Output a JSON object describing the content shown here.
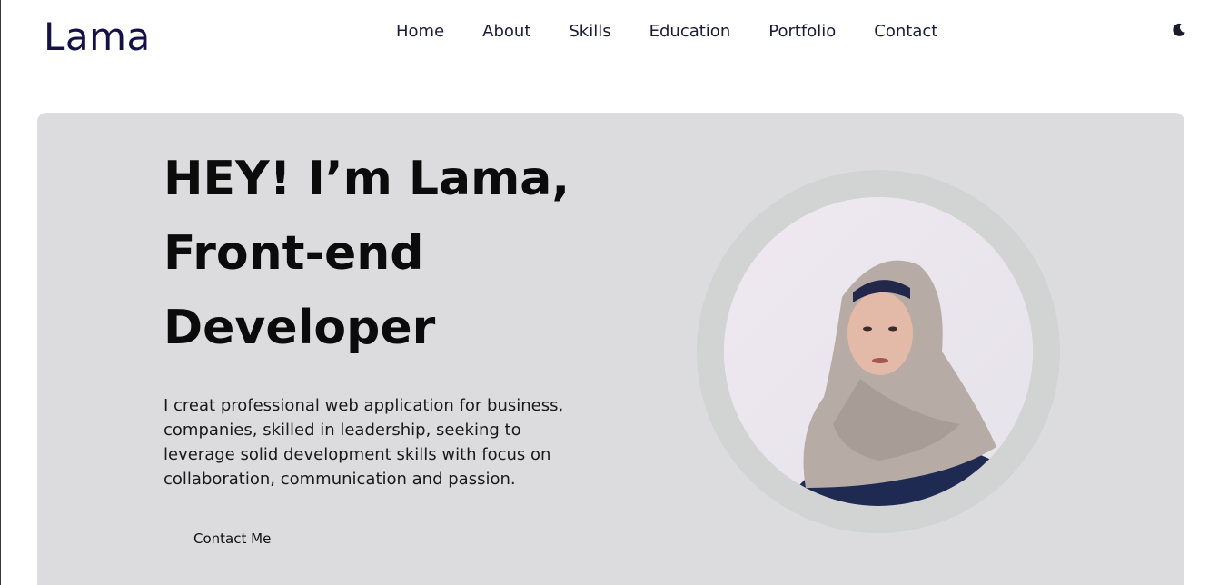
{
  "header": {
    "logo": "Lama",
    "nav": [
      "Home",
      "About",
      "Skills",
      "Education",
      "Portfolio",
      "Contact"
    ],
    "theme_icon": "moon-icon"
  },
  "hero": {
    "title_lines": [
      "HEY! I’m Lama,",
      "Front-end",
      "Developer"
    ],
    "description": "I creat professional web application for business, companies, skilled in leadership, seeking to leverage solid development skills with focus on collaboration, communication and passion.",
    "contact_button": "Contact Me",
    "avatar": "profile-photo"
  },
  "colors": {
    "logo": "#15104a",
    "hero_bg": "#dcdcde",
    "ring": "#d2d3d3"
  }
}
